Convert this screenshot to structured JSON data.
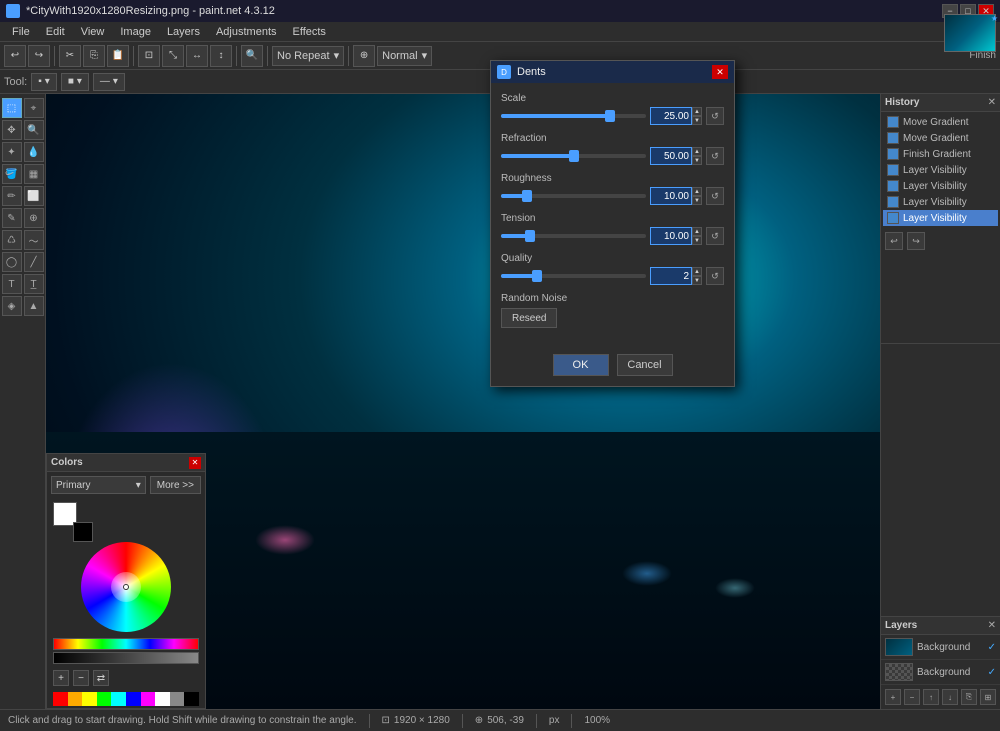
{
  "window": {
    "title": "*CityWith1920x1280Resizing.png - paint.net 4.3.12",
    "close_btn": "✕",
    "min_btn": "−",
    "max_btn": "□"
  },
  "menu": {
    "items": [
      "File",
      "Edit",
      "View",
      "Image",
      "Layers",
      "Adjustments",
      "Effects"
    ]
  },
  "toolbar": {
    "no_repeat_label": "No Repeat",
    "blend_mode": "Normal",
    "finish_label": "Finish"
  },
  "tools": {
    "label": "Tool:"
  },
  "dialog": {
    "title": "Dents",
    "scale_label": "Scale",
    "scale_value": "25.00",
    "refraction_label": "Refraction",
    "refraction_value": "50.00",
    "roughness_label": "Roughness",
    "roughness_value": "10.00",
    "tension_label": "Tension",
    "tension_value": "10.00",
    "quality_label": "Quality",
    "quality_value": "2",
    "random_noise_label": "Random Noise",
    "reseed_btn": "Reseed",
    "ok_btn": "OK",
    "cancel_btn": "Cancel",
    "scale_pct": 75,
    "refraction_pct": 50,
    "roughness_pct": 18,
    "tension_pct": 20,
    "quality_pct": 25
  },
  "history": {
    "title": "History",
    "items": [
      {
        "label": "Move Gradient",
        "color": "#4488cc"
      },
      {
        "label": "Move Gradient",
        "color": "#4488cc"
      },
      {
        "label": "Finish Gradient",
        "color": "#4488cc"
      },
      {
        "label": "Layer Visibility",
        "color": "#4488cc"
      },
      {
        "label": "Layer Visibility",
        "color": "#4488cc"
      },
      {
        "label": "Layer Visibility",
        "color": "#4488cc"
      },
      {
        "label": "Layer Visibility",
        "color": "#4488cc"
      }
    ],
    "active_index": 6
  },
  "layers": {
    "title": "Layers",
    "items": [
      {
        "name": "Background",
        "active": true
      },
      {
        "name": "Background",
        "active": false
      }
    ]
  },
  "colors": {
    "title": "Colors",
    "close_btn": "✕",
    "primary_label": "Primary",
    "more_btn": "More >>"
  },
  "status": {
    "hint": "Click and drag to start drawing. Hold Shift while drawing to constrain the angle.",
    "dimensions": "1920 × 1280",
    "coords": "506, -39",
    "unit": "px",
    "zoom": "100%"
  }
}
